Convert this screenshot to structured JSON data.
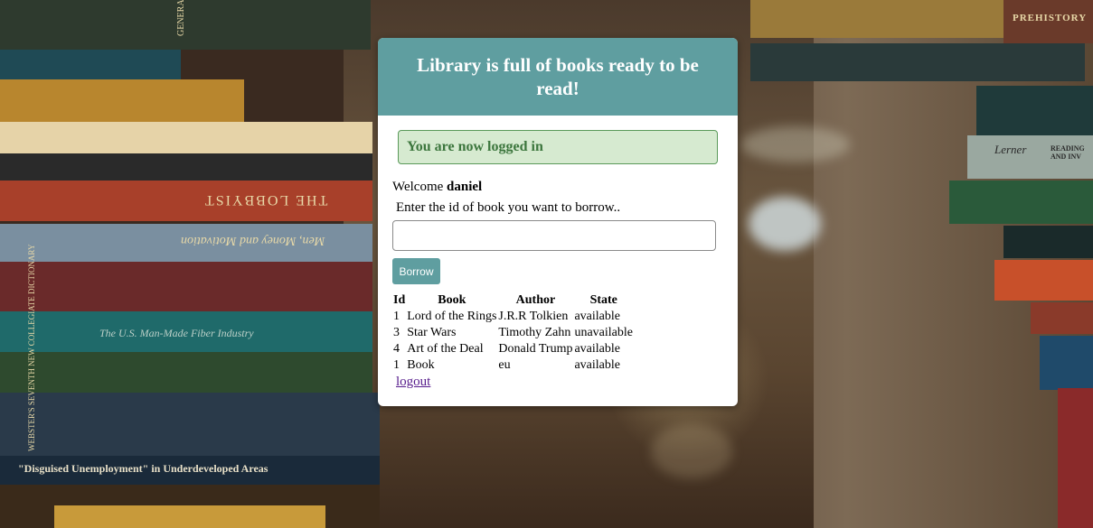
{
  "header": {
    "title": "Library is full of books ready to be read!"
  },
  "alert": {
    "message": "You are now logged in"
  },
  "welcome": {
    "prefix": "Welcome",
    "username": "daniel"
  },
  "borrow": {
    "prompt": "Enter the id of book you want to borrow..",
    "input_value": "",
    "button_label": "Borrow"
  },
  "table": {
    "headers": [
      "Id",
      "Book",
      "Author",
      "State"
    ],
    "rows": [
      [
        "1",
        "Lord of the Rings",
        "J.R.R Tolkien",
        "available"
      ],
      [
        "3",
        "Star Wars",
        "Timothy Zahn",
        "unavailable"
      ],
      [
        "4",
        "Art of the Deal",
        "Donald Trump",
        "available"
      ],
      [
        "1",
        "Book",
        "eu",
        "available"
      ]
    ]
  },
  "logout_label": "logout",
  "background": {
    "spines": [
      "Men, Money and Motivation",
      "THE LOBBYIST",
      "The U.S. Man-Made Fiber Industry",
      "\"Disguised Unemployment\" in Underdeveloped Areas",
      "PREHISTORY",
      "Lerner",
      "READING AND INV",
      "GENERAL THEORY OF VALUE",
      "WEBSTER'S SEVENTH NEW COLLEGIATE DICTIONARY"
    ]
  },
  "colors": {
    "header": "#5f9ea0",
    "alert_bg": "#d6ead0",
    "alert_text": "#3c763d",
    "button": "#5f9ea0"
  }
}
